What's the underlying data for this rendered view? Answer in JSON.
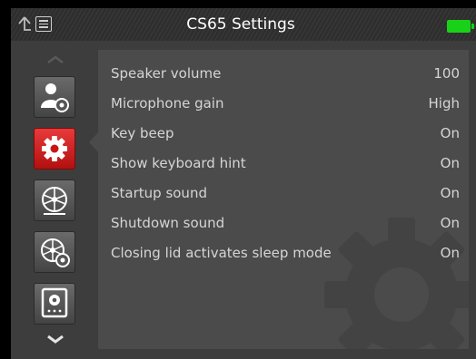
{
  "header": {
    "title": "CS65 Settings",
    "icons": [
      "up-arrow-icon",
      "menu-list-icon",
      "battery-icon"
    ],
    "battery_color": "#19d119"
  },
  "sidebar": {
    "items": [
      {
        "icon": "user-settings-icon",
        "active": false
      },
      {
        "icon": "gear-icon",
        "active": true
      },
      {
        "icon": "reel-icon",
        "active": false
      },
      {
        "icon": "reel-settings-icon",
        "active": false
      },
      {
        "icon": "device-settings-icon",
        "active": false
      }
    ],
    "active_color": "#d42020"
  },
  "settings": [
    {
      "label": "Speaker volume",
      "value": "100"
    },
    {
      "label": "Microphone gain",
      "value": "High"
    },
    {
      "label": "Key beep",
      "value": "On"
    },
    {
      "label": "Show keyboard hint",
      "value": "On"
    },
    {
      "label": "Startup sound",
      "value": "On"
    },
    {
      "label": "Shutdown sound",
      "value": "On"
    },
    {
      "label": "Closing lid activates sleep mode",
      "value": "On"
    }
  ]
}
